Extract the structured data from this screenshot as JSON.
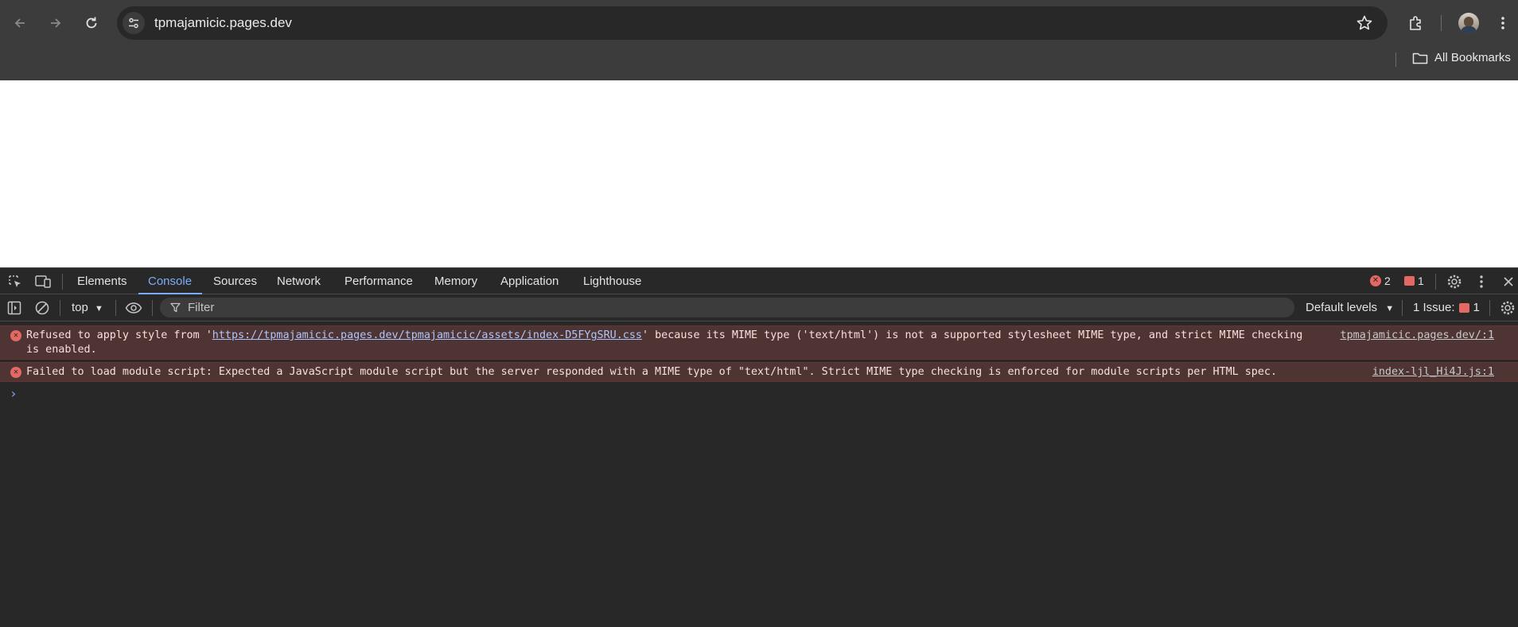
{
  "browser": {
    "url": "tpmajamicic.pages.dev",
    "bookmarks_label": "All Bookmarks"
  },
  "devtools": {
    "tabs": [
      "Elements",
      "Console",
      "Sources",
      "Network",
      "Performance",
      "Memory",
      "Application",
      "Lighthouse"
    ],
    "active_tab": "Console",
    "error_count": "2",
    "issue_count": "1",
    "context": "top",
    "filter_placeholder": "Filter",
    "levels_label": "Default levels",
    "issues_label": "1 Issue:",
    "issues_badge": "1"
  },
  "console": {
    "messages": [
      {
        "prefix": "Refused to apply style from '",
        "link": "https://tpmajamicic.pages.dev/tpmajamicic/assets/index-D5FYgSRU.css",
        "suffix": "' because its MIME type ('text/html') is not a supported stylesheet MIME type, and strict MIME checking",
        "line2": "is enabled.",
        "source": "tpmajamicic.pages.dev/:1"
      },
      {
        "text": "Failed to load module script: Expected a JavaScript module script but the server responded with a MIME type of \"text/html\". Strict MIME type checking is enforced for module scripts per HTML spec.",
        "source": "index-ljl_Hi4J.js:1"
      }
    ],
    "prompt_symbol": "›"
  },
  "colors": {
    "accent": "#7cacf8",
    "error": "#e46962",
    "error_bg": "#4e3534",
    "chrome_bg": "#3c3c3c",
    "devtools_bg": "#282828"
  }
}
